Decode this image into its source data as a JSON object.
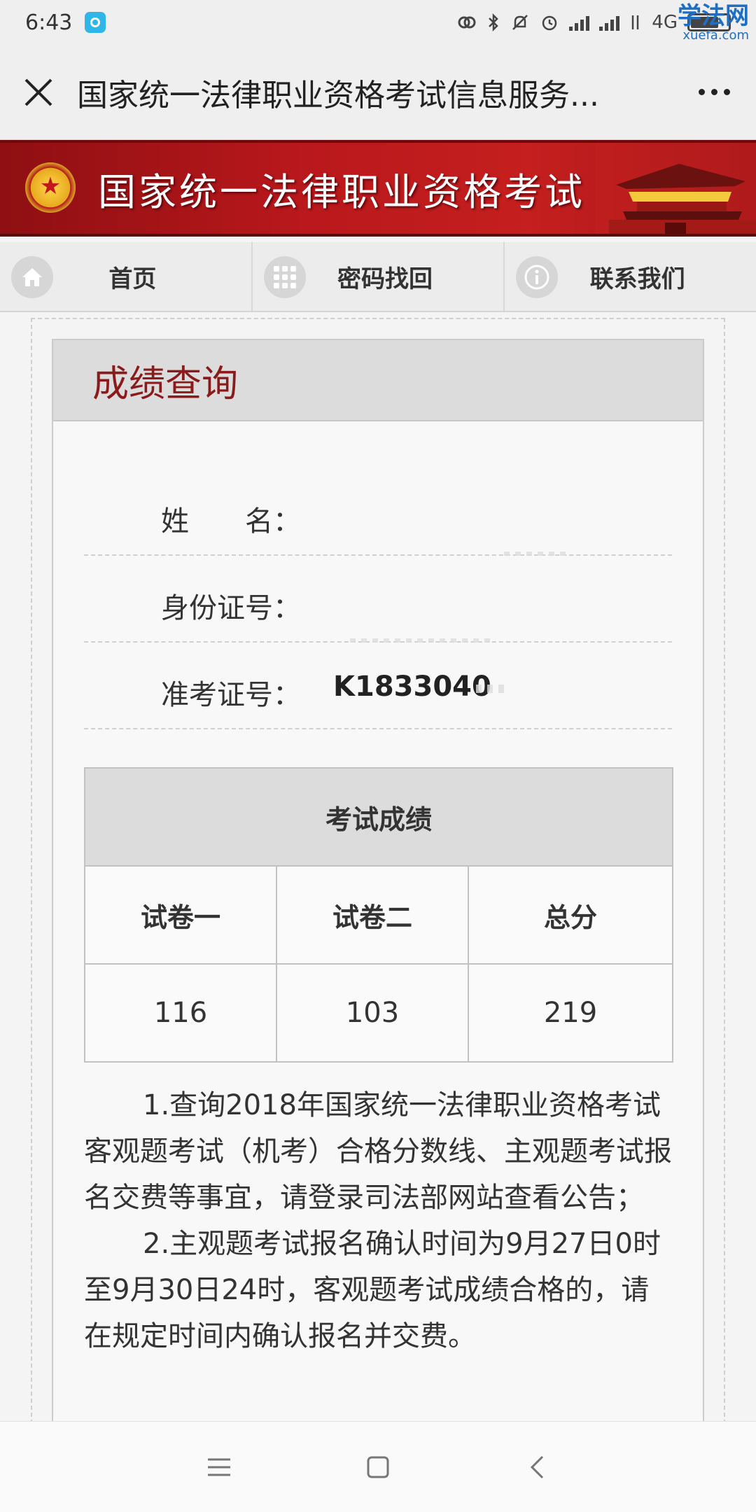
{
  "status_bar": {
    "time": "6:43",
    "network": "4G",
    "watermark_cn": "学法网",
    "watermark_en": "xuefa.com"
  },
  "title_bar": {
    "title": "国家统一法律职业资格考试信息服务..."
  },
  "banner": {
    "title": "国家统一法律职业资格考试"
  },
  "nav": {
    "items": [
      {
        "label": "首页",
        "icon": "home-icon"
      },
      {
        "label": "密码找回",
        "icon": "grid-icon"
      },
      {
        "label": "联系我们",
        "icon": "info-icon"
      }
    ]
  },
  "panel": {
    "heading": "成绩查询",
    "fields": [
      {
        "label": "姓　　名：",
        "value": ""
      },
      {
        "label": "身份证号：",
        "value": ""
      },
      {
        "label": "准考证号：",
        "value": "K1833040"
      }
    ],
    "score_table": {
      "title": "考试成绩",
      "columns": [
        "试卷一",
        "试卷二",
        "总分"
      ],
      "values": [
        "116",
        "103",
        "219"
      ]
    },
    "notes": [
      "1.查询2018年国家统一法律职业资格考试客观题考试（机考）合格分数线、主观题考试报名交费等事宜，请登录司法部网站查看公告；",
      "2.主观题考试报名确认时间为9月27日0时至9月30日24时，客观题考试成绩合格的，请在规定时间内确认报名并交费。"
    ]
  },
  "colors": {
    "banner_red": "#b9181c",
    "heading_red": "#8b1a1a"
  }
}
